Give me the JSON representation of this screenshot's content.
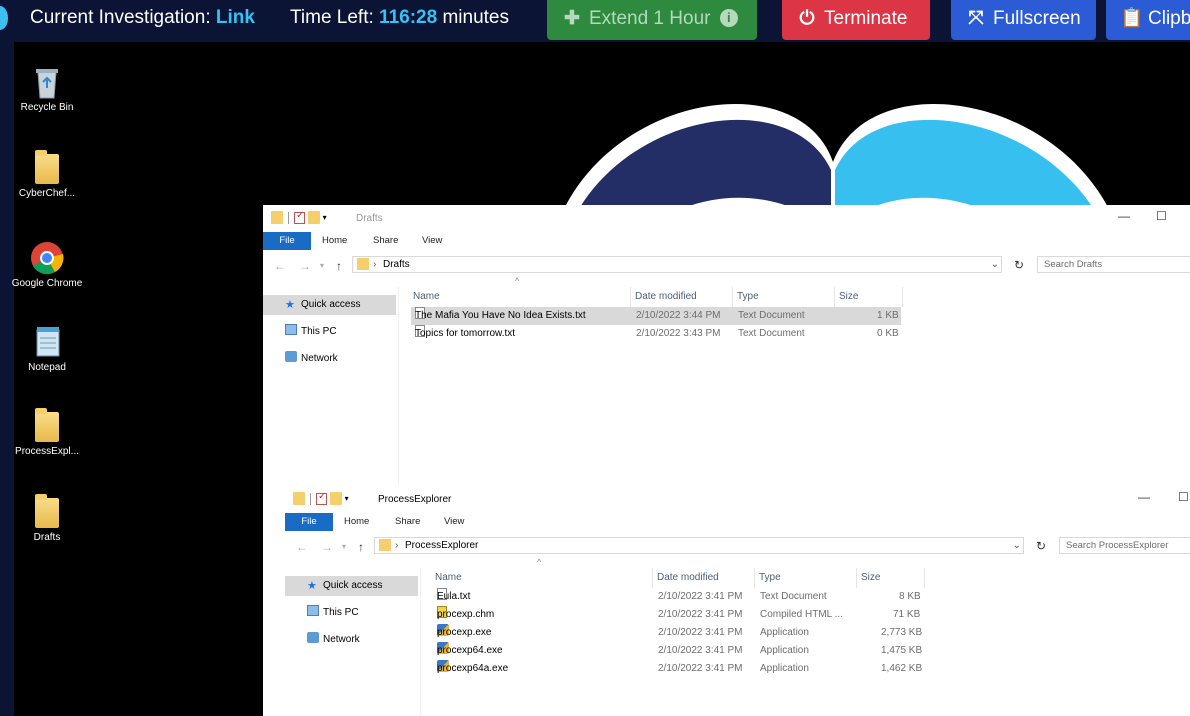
{
  "topbar": {
    "investigation_label": "Current Investigation:",
    "investigation_value": "Link",
    "time_label": "Time Left:",
    "time_value": "116:28",
    "time_unit": "minutes",
    "extend_label": "Extend 1 Hour",
    "terminate_label": "Terminate",
    "fullscreen_label": "Fullscreen",
    "clipboard_label": "Clipb"
  },
  "desktop": {
    "icons": [
      {
        "label": "Recycle Bin"
      },
      {
        "label": "CyberChef..."
      },
      {
        "label": "Google Chrome"
      },
      {
        "label": "Notepad"
      },
      {
        "label": "ProcessExpl..."
      },
      {
        "label": "Drafts"
      }
    ]
  },
  "drafts_window": {
    "title": "Drafts",
    "ribbon": [
      "File",
      "Home",
      "Share",
      "View"
    ],
    "address": "Drafts",
    "search_placeholder": "Search Drafts",
    "nav": [
      "Quick access",
      "This PC",
      "Network"
    ],
    "columns": [
      "Name",
      "Date modified",
      "Type",
      "Size"
    ],
    "files": [
      {
        "name": "The Mafia You Have No Idea Exists.txt",
        "date": "2/10/2022 3:44 PM",
        "type": "Text Document",
        "size": "1 KB"
      },
      {
        "name": "Topics for tomorrow.txt",
        "date": "2/10/2022 3:43 PM",
        "type": "Text Document",
        "size": "0 KB"
      }
    ]
  },
  "procexp_window": {
    "title": "ProcessExplorer",
    "ribbon": [
      "File",
      "Home",
      "Share",
      "View"
    ],
    "address": "ProcessExplorer",
    "search_placeholder": "Search ProcessExplorer",
    "nav": [
      "Quick access",
      "This PC",
      "Network"
    ],
    "columns": [
      "Name",
      "Date modified",
      "Type",
      "Size"
    ],
    "files": [
      {
        "name": "Eula.txt",
        "date": "2/10/2022 3:41 PM",
        "type": "Text Document",
        "size": "8 KB"
      },
      {
        "name": "procexp.chm",
        "date": "2/10/2022 3:41 PM",
        "type": "Compiled HTML ...",
        "size": "71 KB"
      },
      {
        "name": "procexp.exe",
        "date": "2/10/2022 3:41 PM",
        "type": "Application",
        "size": "2,773 KB"
      },
      {
        "name": "procexp64.exe",
        "date": "2/10/2022 3:41 PM",
        "type": "Application",
        "size": "1,475 KB"
      },
      {
        "name": "procexp64a.exe",
        "date": "2/10/2022 3:41 PM",
        "type": "Application",
        "size": "1,462 KB"
      }
    ]
  },
  "colors": {
    "topbar_bg": "#0c1436",
    "accent": "#34c3f5",
    "extend_green": "#2d8a3e",
    "terminate_red": "#dc3545",
    "button_blue": "#2c5bd6",
    "ribbon_file_blue": "#1a6bc4"
  }
}
